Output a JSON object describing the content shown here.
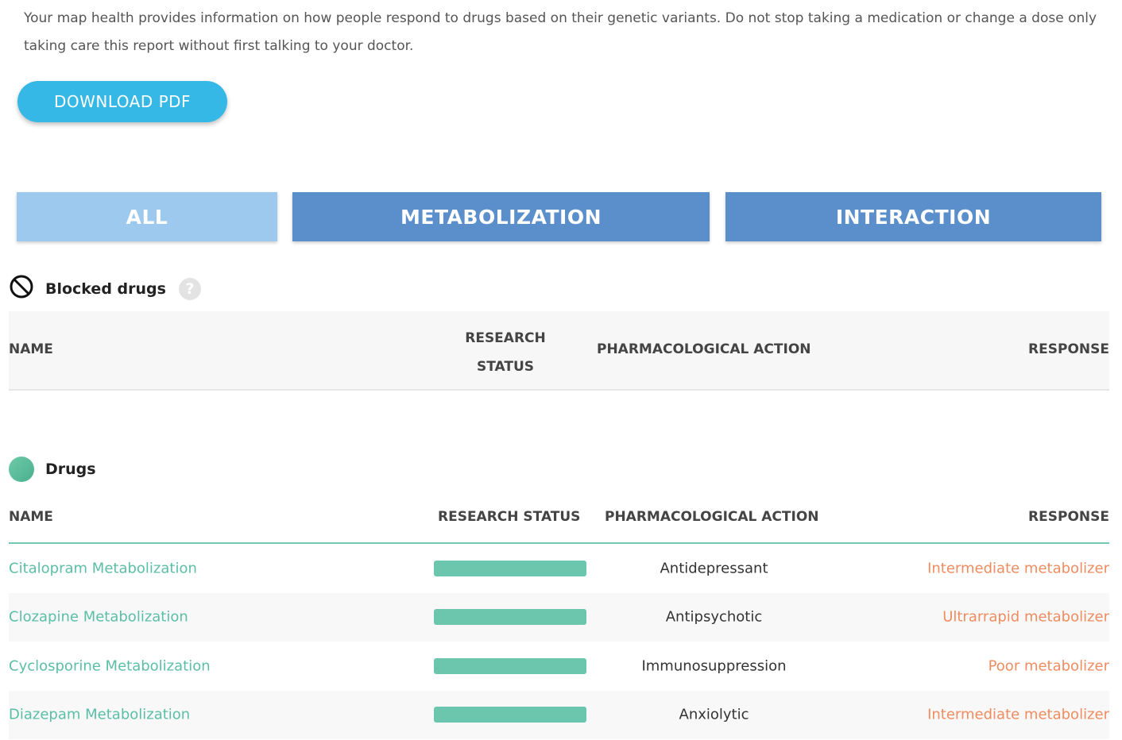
{
  "intro_text": "Your map health provides information on how people respond to drugs based on their genetic variants. Do not stop taking a medication or change a dose only taking care this report without first talking to your doctor.",
  "download_label": "DOWNLOAD PDF",
  "tabs": [
    {
      "label": "ALL",
      "active": true
    },
    {
      "label": "METABOLIZATION",
      "active": false
    },
    {
      "label": "INTERACTION",
      "active": false
    }
  ],
  "blocked": {
    "title": "Blocked drugs",
    "help": "?",
    "headers": {
      "name": "NAME",
      "status": "RESEARCH STATUS",
      "action": "PHARMACOLOGICAL ACTION",
      "response": "RESPONSE"
    }
  },
  "drugs": {
    "title": "Drugs",
    "headers": {
      "name": "NAME",
      "status": "RESEARCH STATUS",
      "action": "PHARMACOLOGICAL ACTION",
      "response": "RESPONSE"
    },
    "rows": [
      {
        "name": "Citalopram Metabolization",
        "status_level": 1.0,
        "action": "Antidepressant",
        "response": "Intermediate metabolizer"
      },
      {
        "name": "Clozapine Metabolization",
        "status_level": 1.0,
        "action": "Antipsychotic",
        "response": "Ultrarrapid metabolizer"
      },
      {
        "name": "Cyclosporine Metabolization",
        "status_level": 1.0,
        "action": "Immunosuppression",
        "response": "Poor metabolizer"
      },
      {
        "name": "Diazepam Metabolization",
        "status_level": 1.0,
        "action": "Anxiolytic",
        "response": "Intermediate metabolizer"
      }
    ]
  },
  "colors": {
    "accent": "#36b8e6",
    "tab_active": "#9ec9ee",
    "tab_inactive": "#5a8fcc",
    "drug_name": "#5bbfa5",
    "response": "#f08c5f",
    "status_bar": "#6cc6ad"
  }
}
